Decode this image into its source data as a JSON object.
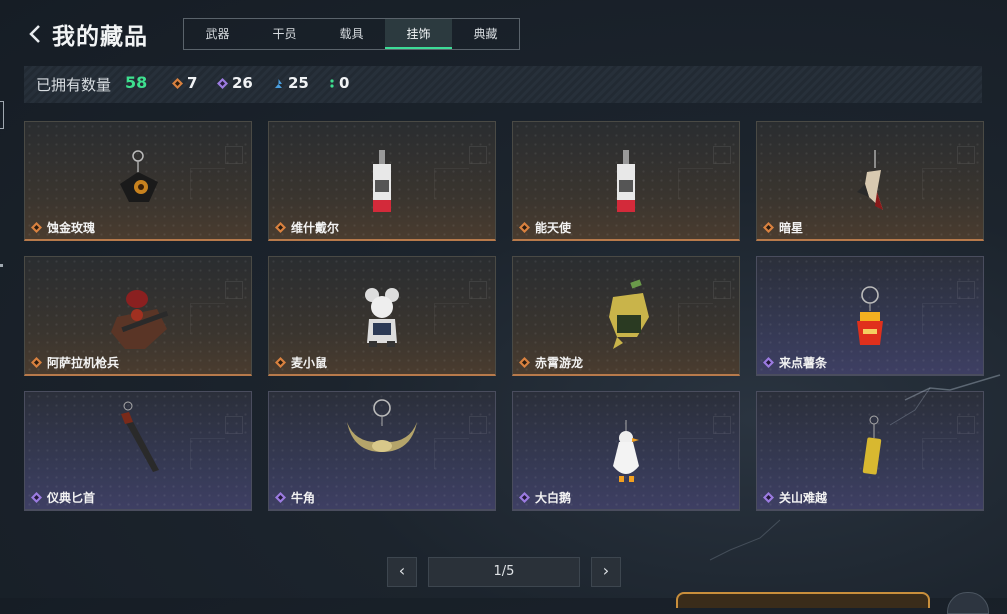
{
  "header": {
    "title": "我的藏品",
    "tabs": [
      {
        "label": "武器",
        "active": false
      },
      {
        "label": "干员",
        "active": false
      },
      {
        "label": "载具",
        "active": false
      },
      {
        "label": "挂饰",
        "active": true
      },
      {
        "label": "典藏",
        "active": false
      }
    ]
  },
  "stats": {
    "label": "已拥有数量",
    "total": "58",
    "orange_count": "7",
    "purple_count": "26",
    "blue_count": "25",
    "green_count": "0"
  },
  "items": [
    {
      "name": "蚀金玫瑰",
      "rarity": "orange",
      "art": "rose-charm-icon"
    },
    {
      "name": "维什戴尔",
      "rarity": "orange",
      "art": "card-charm-icon"
    },
    {
      "name": "能天使",
      "rarity": "orange",
      "art": "card-charm-icon"
    },
    {
      "name": "暗星",
      "rarity": "orange",
      "art": "bird-charm-icon"
    },
    {
      "name": "阿萨拉机枪兵",
      "rarity": "orange",
      "art": "gunner-charm-icon"
    },
    {
      "name": "麦小鼠",
      "rarity": "orange",
      "art": "mouse-charm-icon"
    },
    {
      "name": "赤霄游龙",
      "rarity": "orange",
      "art": "dragon-charm-icon"
    },
    {
      "name": "来点薯条",
      "rarity": "purple",
      "art": "fries-charm-icon"
    },
    {
      "name": "仪典匕首",
      "rarity": "purple",
      "art": "dagger-charm-icon"
    },
    {
      "name": "牛角",
      "rarity": "purple",
      "art": "horn-charm-icon"
    },
    {
      "name": "大白鹅",
      "rarity": "purple",
      "art": "goose-charm-icon"
    },
    {
      "name": "关山难越",
      "rarity": "purple",
      "art": "tube-charm-icon"
    }
  ],
  "pager": {
    "page": "1/5",
    "prev": "‹",
    "next": "›"
  },
  "colors": {
    "accent": "#3ee08f",
    "orange": "#d9813f",
    "purple": "#9b7be0",
    "blue": "#4a9fe0",
    "green": "#3ee08f"
  }
}
